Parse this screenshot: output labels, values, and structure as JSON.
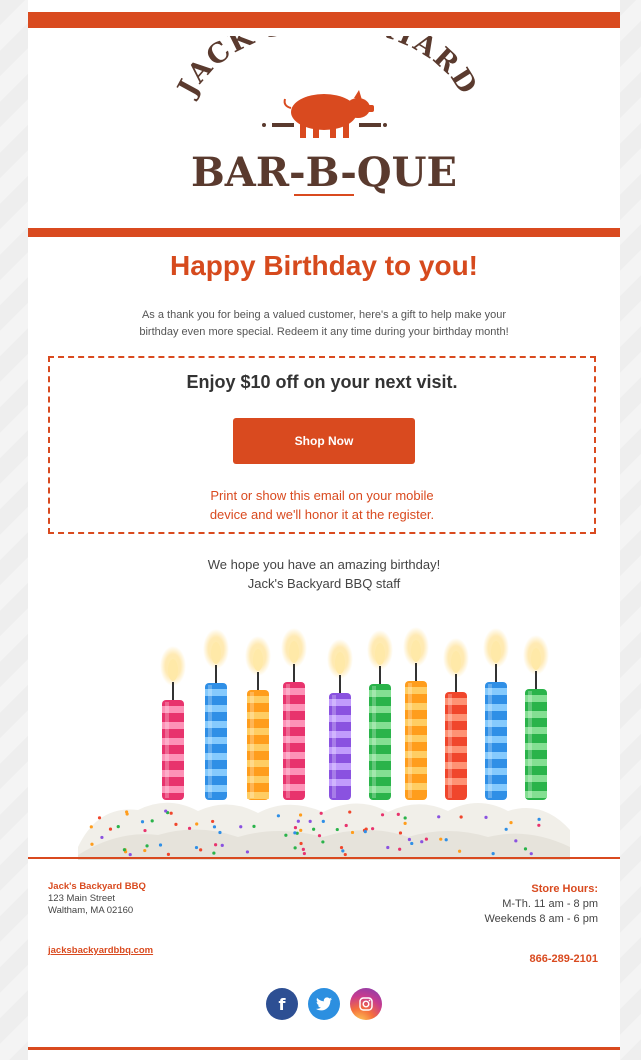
{
  "logo": {
    "line1": "JACK'S BACKYARD",
    "line2": "BAR-B-QUE"
  },
  "headline": "Happy Birthday to you!",
  "intro": {
    "line1": "As a thank you for being a valued customer, here's a gift to help make your",
    "line2": "birthday even more special. Redeem it any time during your birthday month!"
  },
  "coupon": {
    "title": "Enjoy $10 off on your next visit.",
    "button_label": "Shop Now",
    "note_line1": "Print or show this email on your mobile",
    "note_line2": "device and we'll honor it at the register."
  },
  "closing": {
    "line1": "We hope you have an amazing birthday!",
    "line2": "Jack's Backyard BBQ staff"
  },
  "footer": {
    "company": "Jack's Backyard BBQ",
    "street": "123 Main Street",
    "city": "Waltham, MA 02160",
    "website": "jacksbackyardbbq.com",
    "hours_title": "Store Hours:",
    "hours_weekday": "M-Th. 11 am - 8 pm",
    "hours_weekend": "Weekends 8 am - 6 pm",
    "phone": "866-289-2101"
  },
  "social": [
    {
      "name": "facebook-icon",
      "glyph": "f"
    },
    {
      "name": "twitter-icon",
      "glyph": "t"
    },
    {
      "name": "instagram-icon",
      "glyph": "◎"
    }
  ],
  "colors": {
    "brand": "#d94a1f",
    "logo_brown": "#5a3a2e"
  }
}
